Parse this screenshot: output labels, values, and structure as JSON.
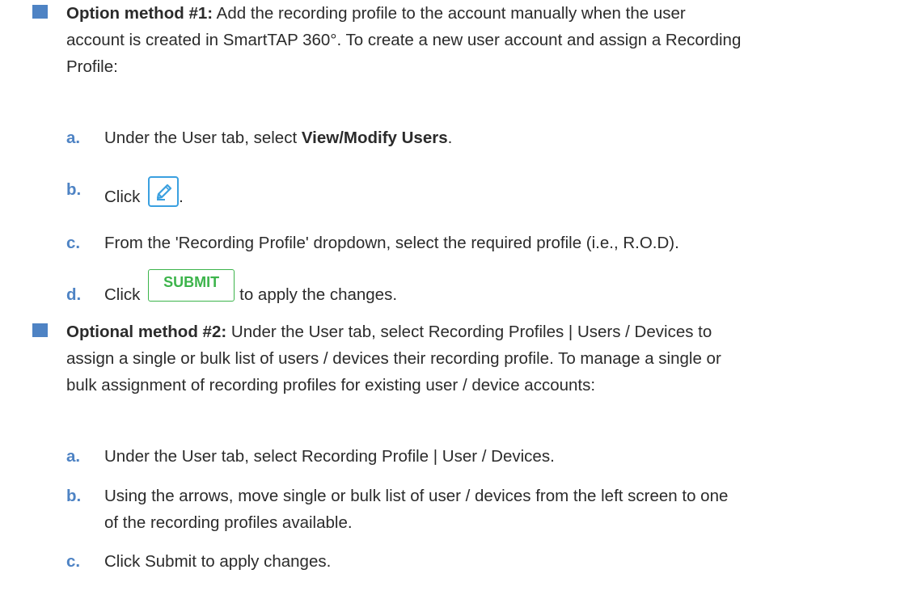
{
  "colors": {
    "bullet": "#4e83c4",
    "sub_letter": "#4e83c4",
    "edit_icon": "#3aa0e0",
    "submit_button": "#3cb44b",
    "text": "#2b2b2b"
  },
  "method1": {
    "lead": "Option method #1:",
    "line1": "Add the recording profile to the account manually when the user",
    "line2": "account is created in SmartTAP 360°. To create a new user account and assign a Recording",
    "line3": "Profile:",
    "steps": {
      "a": {
        "letter": "a.",
        "pre": "Under the User tab, select ",
        "bold": "View/Modify Users",
        "post": "."
      },
      "b": {
        "letter": "b.",
        "pre": "Click",
        "icon": "pencil-edit-icon",
        "post": "."
      },
      "c": {
        "letter": "c.",
        "text": "From the 'Recording Profile' dropdown, select the required profile (i.e., R.O.D)."
      },
      "d": {
        "letter": "d.",
        "pre": "Click",
        "button_label": "SUBMIT",
        "post": "to apply the changes."
      }
    }
  },
  "method2": {
    "lead": "Optional method #2:",
    "line1": "Under the User tab, select Recording Profiles | Users / Devices to",
    "line2": "assign a single or bulk list of users / devices their recording profile. To manage a single or",
    "line3": "bulk assignment of recording profiles for existing user / device accounts:",
    "steps": {
      "a": {
        "letter": "a.",
        "text": "Under the User tab, select Recording Profile | User / Devices."
      },
      "b": {
        "letter": "b.",
        "line1": "Using the arrows, move single or bulk list of user / devices from the left screen to one",
        "line2": "of the recording profiles available."
      },
      "c": {
        "letter": "c.",
        "text": "Click Submit to apply changes."
      }
    }
  }
}
